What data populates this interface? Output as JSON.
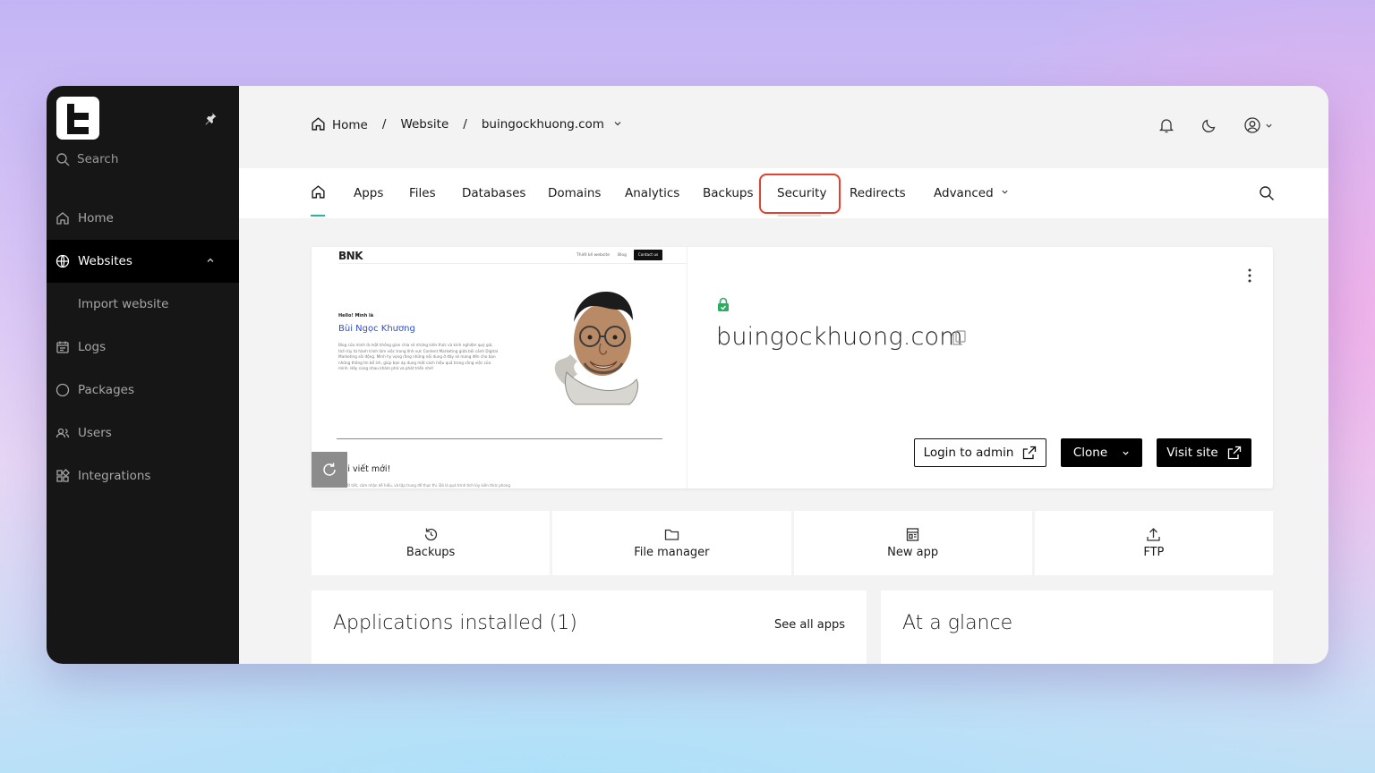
{
  "colors": {
    "sidebar_bg": "#161616",
    "accent_underline": "#2bb594",
    "highlight_box": "#e53f2e",
    "ssl_green": "#27ae60"
  },
  "sidebar": {
    "search_placeholder": "Search",
    "items": [
      {
        "label": "Home",
        "icon": "home-icon"
      },
      {
        "label": "Websites",
        "icon": "globe-icon",
        "active": true
      },
      {
        "label": "Import website",
        "sub": true
      },
      {
        "label": "Logs",
        "icon": "calendar-icon"
      },
      {
        "label": "Packages",
        "icon": "circle-icon"
      },
      {
        "label": "Users",
        "icon": "users-icon"
      },
      {
        "label": "Integrations",
        "icon": "grid-icon"
      }
    ]
  },
  "breadcrumb": {
    "home": "Home",
    "section": "Website",
    "current": "buingockhuong.com",
    "separator": "/"
  },
  "tabs": [
    "Apps",
    "Files",
    "Databases",
    "Domains",
    "Analytics",
    "Backups",
    "Security",
    "Redirects",
    "Advanced"
  ],
  "site": {
    "domain": "buingockhuong.com",
    "buttons": {
      "login": "Login to admin",
      "clone": "Clone",
      "visit": "Visit site"
    },
    "preview": {
      "logo": "BNK",
      "nav_links": [
        "Thiết kế website",
        "Blog"
      ],
      "nav_cta": "Contact us",
      "hello": "Hello! Mình là",
      "name": "Bùi Ngọc Khương",
      "description": "Blog của mình là một không gian chia sẻ những kiến thức và kinh nghiệm quý giá, tích lũy từ hành trình làm việc trong lĩnh vực Content Marketing giữa bối cảnh Digital Marketing sôi động. Mình hy vọng rằng những nội dung ở đây sẽ mang đến cho bạn những thông tin bổ ích, giúp bạn áp dụng một cách hiệu quả trong công việc của mình. Hãy cùng nhau khám phá và phát triển nhé!",
      "post_title": "Bài viết mới!",
      "post_desc": "Bài viết tiết, cảm nhận dễ hiểu, và tập trung để thực thi. Đó là quá trình tích lũy kiến thức phong"
    }
  },
  "quick_actions": [
    "Backups",
    "File manager",
    "New app",
    "FTP"
  ],
  "panels": {
    "apps_title": "Applications installed (1)",
    "apps_link": "See all apps",
    "glance_title": "At a glance"
  }
}
